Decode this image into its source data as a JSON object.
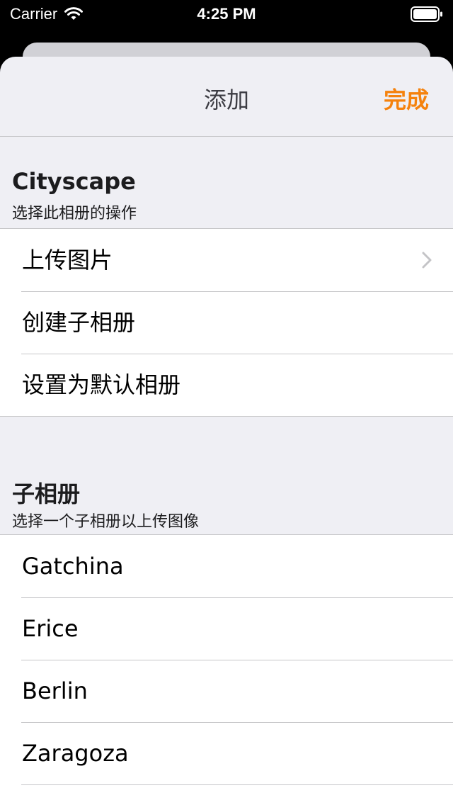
{
  "status_bar": {
    "carrier": "Carrier",
    "time": "4:25 PM",
    "icons": [
      "wifi-icon",
      "battery-icon"
    ]
  },
  "nav": {
    "title": "添加",
    "done_label": "完成",
    "accent_color": "#f5820d"
  },
  "album_section": {
    "title": "Cityscape",
    "subtitle": "选择此相册的操作",
    "actions": [
      {
        "label": "上传图片",
        "has_chevron": true
      },
      {
        "label": "创建子相册"
      },
      {
        "label": "设置为默认相册"
      }
    ]
  },
  "subalbum_section": {
    "title": "子相册",
    "subtitle": "选择一个子相册以上传图像",
    "items": [
      {
        "label": "Gatchina"
      },
      {
        "label": "Erice"
      },
      {
        "label": "Berlin"
      },
      {
        "label": "Zaragoza"
      }
    ]
  }
}
